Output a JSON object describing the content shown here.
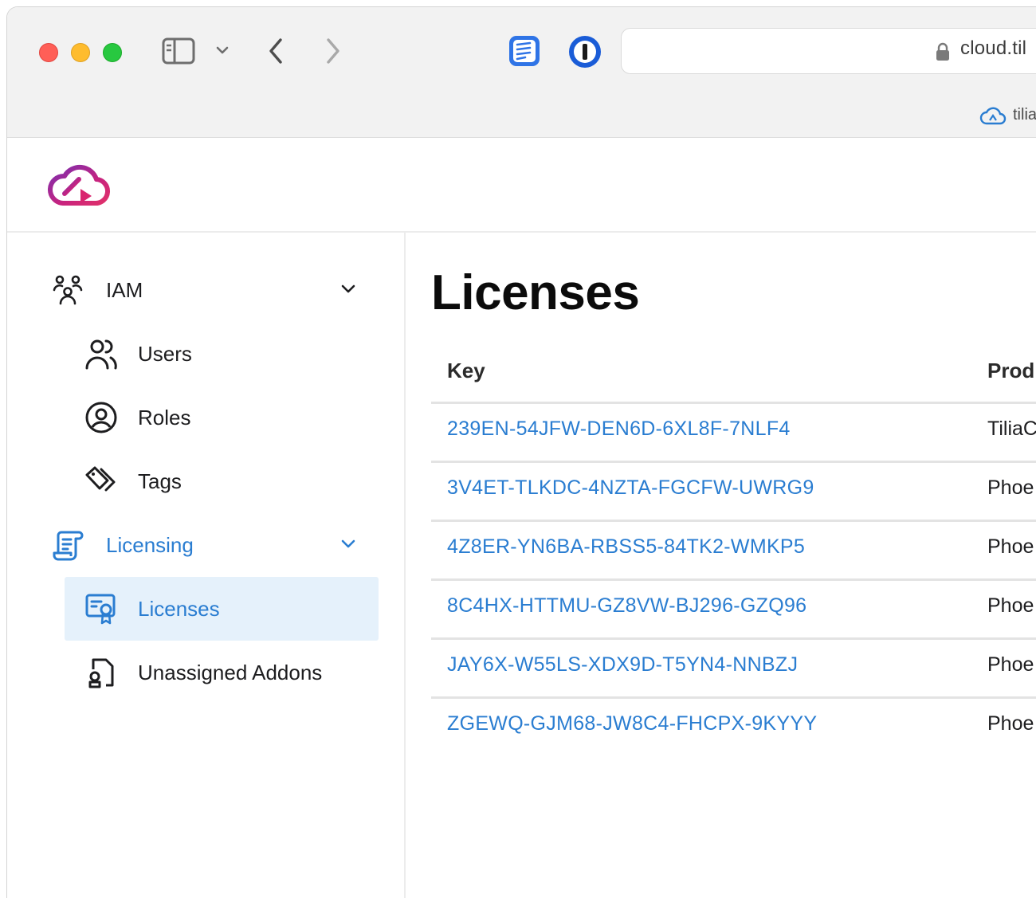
{
  "browser": {
    "address": "cloud.til",
    "tab_label": "tilia",
    "colors": {
      "red": "#ff5f57",
      "yellow": "#febc2e",
      "green": "#28c840"
    }
  },
  "sidebar": {
    "items": [
      {
        "label": "IAM",
        "icon": "users-group-icon"
      },
      {
        "label": "Users",
        "icon": "users-icon"
      },
      {
        "label": "Roles",
        "icon": "user-circle-icon"
      },
      {
        "label": "Tags",
        "icon": "tags-icon"
      },
      {
        "label": "Licensing",
        "icon": "scroll-icon"
      },
      {
        "label": "Licenses",
        "icon": "certificate-icon"
      },
      {
        "label": "Unassigned Addons",
        "icon": "file-badge-icon"
      }
    ]
  },
  "main": {
    "title": "Licenses",
    "columns": [
      "Key",
      "Prod"
    ],
    "rows": [
      {
        "key": "239EN-54JFW-DEN6D-6XL8F-7NLF4",
        "product": "TiliaC"
      },
      {
        "key": "3V4ET-TLKDC-4NZTA-FGCFW-UWRG9",
        "product": "Phoe"
      },
      {
        "key": "4Z8ER-YN6BA-RBSS5-84TK2-WMKP5",
        "product": "Phoe"
      },
      {
        "key": "8C4HX-HTTMU-GZ8VW-BJ296-GZQ96",
        "product": "Phoe"
      },
      {
        "key": "JAY6X-W55LS-XDX9D-T5YN4-NNBZJ",
        "product": "Phoe"
      },
      {
        "key": "ZGEWQ-GJM68-JW8C4-FHCPX-9KYYY",
        "product": "Phoe"
      }
    ]
  },
  "theme": {
    "accent": "#2a7dd1",
    "selected_bg": "#e5f1fb"
  }
}
